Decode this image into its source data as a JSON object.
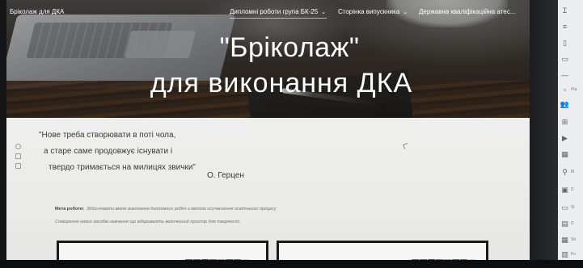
{
  "site": {
    "name": "Бріколаж для ДКА",
    "nav": [
      {
        "label": "Дипломні роботи група БК-25",
        "has_dropdown": true
      },
      {
        "label": "Сторінка випускника",
        "has_dropdown": true
      },
      {
        "label": "Державна кваліфікаційна атес..."
      }
    ]
  },
  "hero": {
    "title": "\"Бріколаж\"",
    "subtitle": "для виконання  ДКА"
  },
  "quote": {
    "lines": [
      "\"Нове треба створювати в поті чола,",
      "а старе саме продовжує існувати і",
      "твердо тримається на милицях звички\""
    ],
    "author": "О. Герцен"
  },
  "goal": {
    "label": "Мета роботи:",
    "line1": "Здійснювати вміле виконання дипломних робіт з метою осучаснення освітнього процесу",
    "line2": "Створення нових засобів навчання що відкривають величезний простір для творчості."
  },
  "cards": [
    {
      "tile_colors": [
        "#e53935",
        "#1e88e5",
        "#8e24aa",
        "#43a047",
        "#fb8c00",
        "#e53935",
        "#1e88e5",
        "#fdd835"
      ]
    },
    {
      "tile_colors": [
        "#e53935",
        "#1e88e5",
        "#8e24aa",
        "#43a047",
        "#fb8c00",
        "#e53935",
        "#1e88e5",
        "#fdd835"
      ]
    }
  ],
  "sidebar": {
    "items": [
      {
        "icon": "text-box-icon",
        "label": ""
      },
      {
        "icon": "divider-icon",
        "label": ""
      },
      {
        "icon": "carousel-icon",
        "label": ""
      },
      {
        "icon": "button-icon",
        "label": ""
      },
      {
        "icon": "line-divider-icon",
        "label": ""
      },
      {
        "icon": "placeholder-icon",
        "label": "Pla"
      },
      {
        "icon": "people-icon",
        "label": ""
      },
      {
        "icon": "embed-icon",
        "label": ""
      },
      {
        "icon": "youtube-icon",
        "label": ""
      },
      {
        "icon": "calendar-icon",
        "label": ""
      },
      {
        "icon": "map-icon",
        "label": "M"
      },
      {
        "icon": "drive-icon",
        "label": "D"
      },
      {
        "icon": "slides-icon",
        "label": "Sl"
      },
      {
        "icon": "docs-icon",
        "label": "D"
      },
      {
        "icon": "sheets-icon",
        "label": "Sh"
      },
      {
        "icon": "forms-icon",
        "label": "Fo"
      }
    ]
  },
  "colors": {
    "hero_text": "#ffffff",
    "body_text": "#3a3a3a",
    "sidebar_bg": "#ecedee"
  }
}
